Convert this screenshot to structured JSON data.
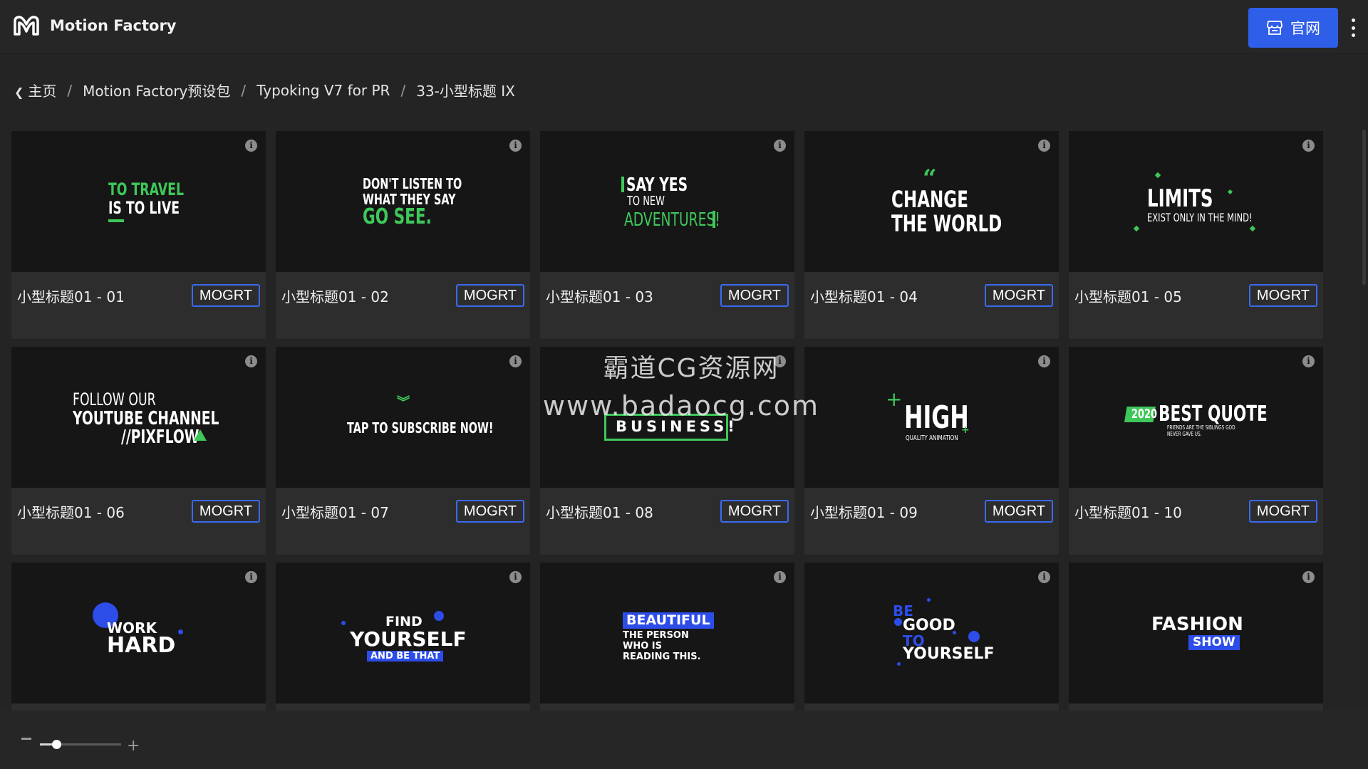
{
  "app": {
    "name": "Motion Factory"
  },
  "header": {
    "site_button": "官网"
  },
  "breadcrumb": [
    "主页",
    "Motion Factory预设包",
    "Typoking V7 for PR",
    "33-小型标题 IX"
  ],
  "cards": [
    {
      "title": "小型标题01 - 01",
      "badge": "MOGRT",
      "preview": [
        "TO TRAVEL",
        "IS TO LIVE"
      ]
    },
    {
      "title": "小型标题01 - 02",
      "badge": "MOGRT",
      "preview": [
        "DON'T LISTEN TO",
        "WHAT THEY SAY",
        "GO SEE."
      ]
    },
    {
      "title": "小型标题01 - 03",
      "badge": "MOGRT",
      "preview": [
        "SAY YES",
        "TO NEW",
        "ADVENTURES!"
      ]
    },
    {
      "title": "小型标题01 - 04",
      "badge": "MOGRT",
      "preview": [
        "CHANGE",
        "THE WORLD"
      ]
    },
    {
      "title": "小型标题01 - 05",
      "badge": "MOGRT",
      "preview": [
        "LIMITS",
        "EXIST ONLY IN THE MIND!"
      ]
    },
    {
      "title": "小型标题01 - 06",
      "badge": "MOGRT",
      "preview": [
        "FOLLOW OUR",
        "YOUTUBE CHANNEL",
        "//PIXFLOW"
      ]
    },
    {
      "title": "小型标题01 - 07",
      "badge": "MOGRT",
      "preview": [
        "TAP TO SUBSCRIBE NOW!"
      ]
    },
    {
      "title": "小型标题01 - 08",
      "badge": "MOGRT",
      "preview": [
        "BUSINESS!"
      ]
    },
    {
      "title": "小型标题01 - 09",
      "badge": "MOGRT",
      "preview": [
        "HIGH",
        "QUALITY ANIMATION"
      ]
    },
    {
      "title": "小型标题01 - 10",
      "badge": "MOGRT",
      "preview": [
        "2020",
        "BEST QUOTE",
        "FRIENDS ARE THE SIBLINGS GOD",
        "NEVER GAVE US."
      ]
    },
    {
      "title": "",
      "badge": "",
      "preview": [
        "WORK",
        "HARD"
      ]
    },
    {
      "title": "",
      "badge": "",
      "preview": [
        "FIND",
        "YOURSELF",
        "AND BE THAT"
      ]
    },
    {
      "title": "",
      "badge": "",
      "preview": [
        "BEAUTIFUL",
        "THE PERSON",
        "WHO IS",
        "READING THIS."
      ]
    },
    {
      "title": "",
      "badge": "",
      "preview": [
        "BE",
        "GOOD",
        "TO",
        "YOURSELF"
      ]
    },
    {
      "title": "",
      "badge": "",
      "preview": [
        "FASHION",
        "SHOW"
      ]
    }
  ],
  "watermark": [
    "霸道CG资源网",
    "www.badaocg.com"
  ],
  "zoom": {
    "minus": "−",
    "plus": "+",
    "level": 0.2
  },
  "colors": {
    "accent": "#2f5ee8",
    "green": "#3ec85a",
    "preview_blue": "#2d4de9",
    "background": "#242424"
  }
}
